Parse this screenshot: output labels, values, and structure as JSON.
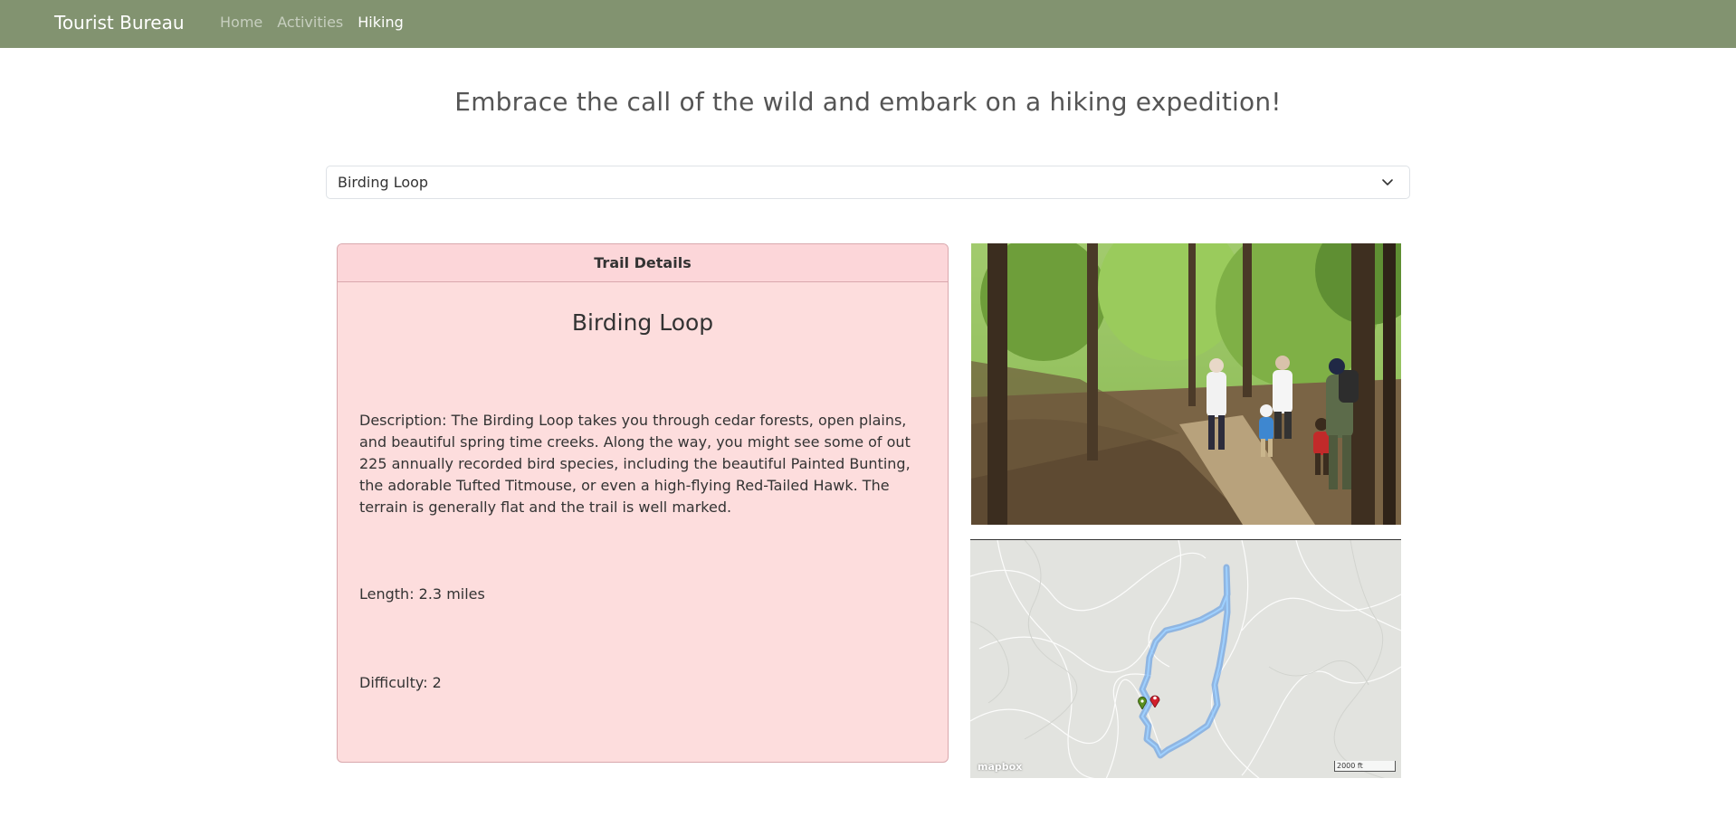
{
  "nav": {
    "brand": "Tourist Bureau",
    "links": [
      {
        "label": "Home",
        "active": false
      },
      {
        "label": "Activities",
        "active": false
      },
      {
        "label": "Hiking",
        "active": true
      }
    ]
  },
  "headline": "Embrace the call of the wild and embark on a hiking expedition!",
  "trail_select": {
    "selected": "Birding Loop"
  },
  "card": {
    "header": "Trail Details",
    "name": "Birding Loop",
    "description": "Description: The Birding Loop takes you through cedar forests, open plains, and beautiful spring time creeks. Along the way, you might see some of out 225 annually recorded bird species, including the beautiful Painted Bunting, the adorable Tufted Titmouse, or even a high-flying Red-Tailed Hawk. The terrain is generally flat and the trail is well marked.",
    "length": "Length: 2.3 miles",
    "difficulty": "Difficulty: 2"
  },
  "map": {
    "logo": "mapbox",
    "scale": "2000 ft"
  },
  "colors": {
    "navbar": "#829370",
    "card_bg": "#fddddd",
    "card_border": "#d9a8ad",
    "route": "#4a90e2"
  },
  "icons": [
    "chevron-down-icon",
    "start-marker-icon",
    "end-marker-icon"
  ]
}
